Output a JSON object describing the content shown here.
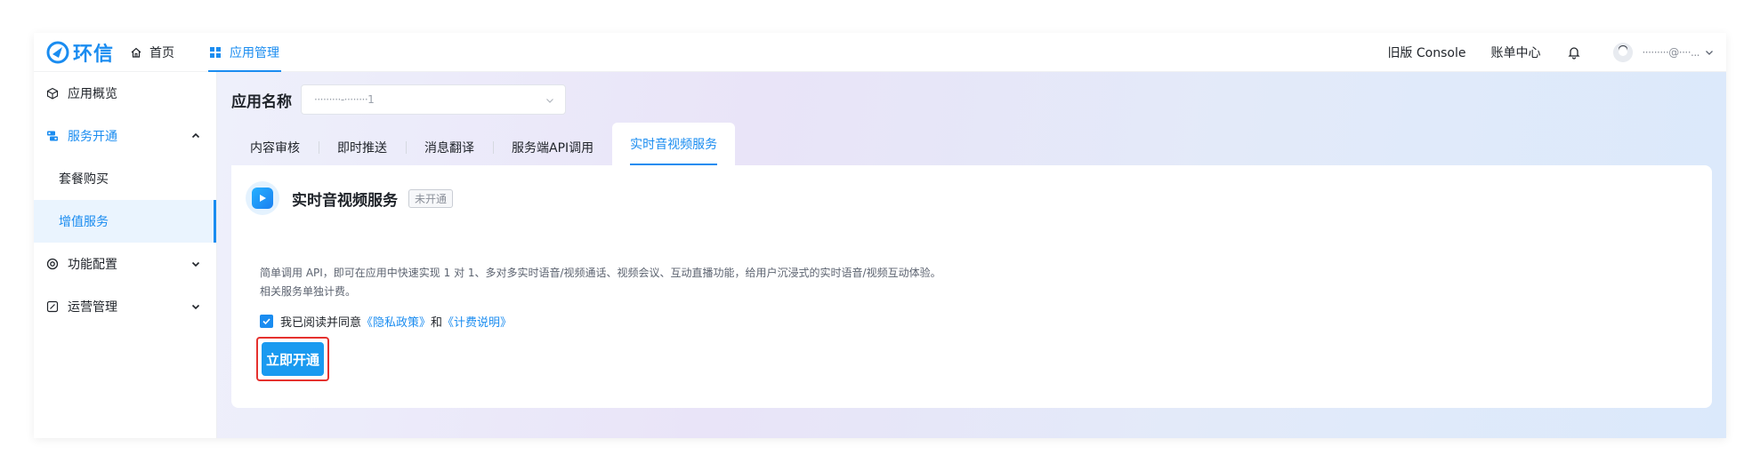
{
  "app": {
    "logo_text": "环信",
    "nav": {
      "home": "首页",
      "app_management": "应用管理"
    },
    "top_right": {
      "old_console": "旧版 Console",
      "billing": "账单中心",
      "user_display": "·········@····..."
    }
  },
  "sidebar": {
    "items": [
      {
        "label": "应用概览",
        "icon": "cube-icon"
      },
      {
        "label": "服务开通",
        "icon": "service-icon",
        "expanded": true
      },
      {
        "label": "功能配置",
        "icon": "settings-icon"
      },
      {
        "label": "运营管理",
        "icon": "edit-icon"
      }
    ],
    "sub_items": [
      {
        "label": "套餐购买"
      },
      {
        "label": "增值服务",
        "selected": true
      }
    ]
  },
  "main": {
    "app_name_label": "应用名称",
    "app_name_value": "·········-········1",
    "tabs": [
      {
        "label": "内容审核"
      },
      {
        "label": "即时推送"
      },
      {
        "label": "消息翻译"
      },
      {
        "label": "服务端API调用"
      },
      {
        "label": "实时音视频服务",
        "active": true
      }
    ],
    "service": {
      "title": "实时音视频服务",
      "status_badge": "未开通",
      "description_line1": "简单调用 API，即可在应用中快速实现 1 对 1、多对多实时语音/视频通话、视频会议、互动直播功能，给用户沉浸式的实时语音/视频互动体验。",
      "description_line2": "相关服务单独计费。",
      "agree_prefix": "我已阅读并同意",
      "privacy_link": "《隐私政策》",
      "and_text": "和",
      "billing_link": "《计费说明》",
      "agree_checked": true,
      "activate_button": "立即开通"
    }
  },
  "colors": {
    "accent": "#1a8cf0",
    "highlight_border": "#e5312e"
  }
}
